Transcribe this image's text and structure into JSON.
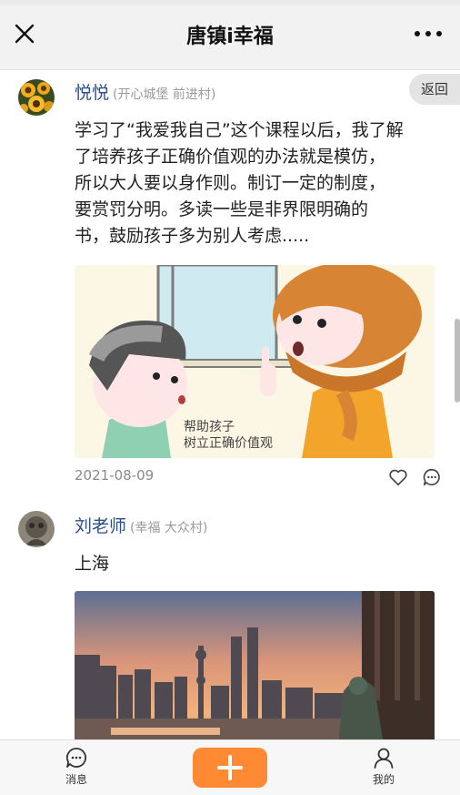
{
  "header": {
    "title": "唐镇i幸福"
  },
  "posts": [
    {
      "author": "悦悦",
      "location": "(开心城堡 前进村)",
      "back_label": "返回",
      "lines": [
        "学习了“我爱我自己”这个课程以后，我了解",
        "了培养孩子正确价值观的办法就是模仿，",
        "所以大人要以身作则。制订一定的制度，",
        "要赏罚分明。多读一些是非界限明确的",
        "书，鼓励孩子多为别人考虑....."
      ],
      "image_caption": [
        "帮助孩子",
        "树立正确价值观"
      ],
      "date": "2021-08-09"
    },
    {
      "author": "刘老师",
      "location": "(幸福 大众村)",
      "text": "上海"
    }
  ],
  "tabbar": {
    "messages_label": "消息",
    "mine_label": "我的"
  },
  "colors": {
    "accent": "#ff8a33",
    "author": "#2c4f8a"
  }
}
